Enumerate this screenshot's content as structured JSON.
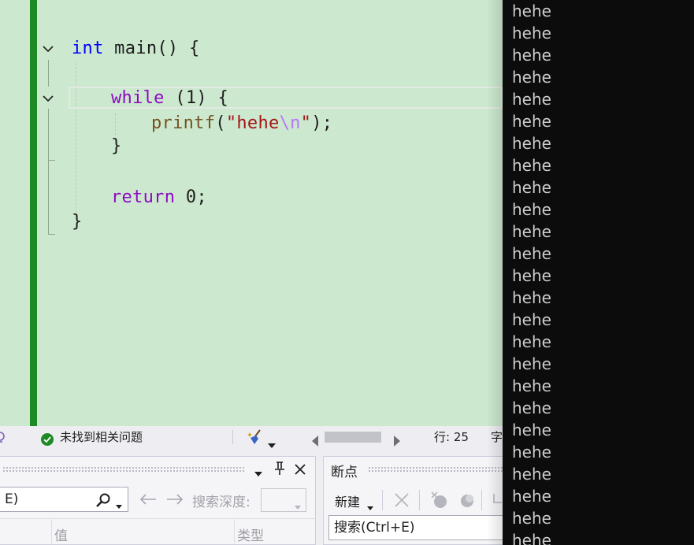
{
  "editor": {
    "code": {
      "l1_type": "int",
      "l1_rest": " main() {",
      "l2_kw": "while",
      "l2_rest": " (1) {",
      "l3_fn": "printf",
      "l3_open": "(",
      "l3_q1": "\"",
      "l3_str": "hehe",
      "l3_esc": "\\n",
      "l3_q2": "\"",
      "l3_close": ");",
      "l4": "}",
      "l5_kw": "return",
      "l5_rest": " 0;",
      "l6": "}"
    }
  },
  "status_bar": {
    "issues_text": "未找到相关问题",
    "line_label": "行: 25",
    "char_label_partial": "字"
  },
  "locals_panel": {
    "search_value_partial": "E)",
    "search_depth_label": "搜索深度:",
    "col_value": "值",
    "col_type": "类型"
  },
  "breakpoints_panel": {
    "title": "断点",
    "new_label": "新建",
    "search_placeholder": "搜索(Ctrl+E)"
  },
  "console": {
    "lines": [
      "hehe",
      "hehe",
      "hehe",
      "hehe",
      "hehe",
      "hehe",
      "hehe",
      "hehe",
      "hehe",
      "hehe",
      "hehe",
      "hehe",
      "hehe",
      "hehe",
      "hehe",
      "hehe",
      "hehe",
      "hehe",
      "hehe",
      "hehe",
      "hehe",
      "hehe",
      "hehe",
      "hehe",
      "hehe"
    ]
  },
  "colors": {
    "editor_bg": "#cce8cf",
    "change_bar": "#1e8a25",
    "keyword": "#0000ff",
    "control_keyword": "#8f08c4",
    "function": "#74531f",
    "string": "#a31515",
    "escape": "#b776fb",
    "console_bg": "#0c0c0c",
    "console_text": "#cccccc"
  }
}
